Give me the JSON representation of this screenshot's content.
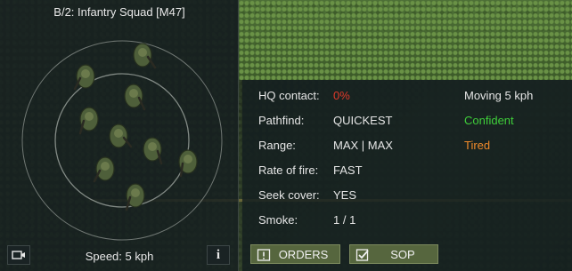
{
  "unit": {
    "title": "B/2: Infantry Squad [M47]",
    "speed": "Speed: 5 kph",
    "info_label": "i"
  },
  "stats": {
    "hq_contact_label": "HQ contact:",
    "hq_contact_value": "0%",
    "pathfind_label": "Pathfind:",
    "pathfind_value": "QUICKEST",
    "range_label": "Range:",
    "range_value": "MAX | MAX",
    "rate_label": "Rate of fire:",
    "rate_value": "FAST",
    "cover_label": "Seek cover:",
    "cover_value": "YES",
    "smoke_label": "Smoke:",
    "smoke_value": "1 / 1"
  },
  "status": {
    "movement": "Moving 5 kph",
    "morale": "Confident",
    "fatigue": "Tired"
  },
  "buttons": {
    "orders": "ORDERS",
    "sop": "SOP"
  },
  "colors": {
    "hq_contact_value": "#e03a2a",
    "morale": "#3fcf3a",
    "fatigue": "#f08a2a",
    "button_bg": "#56663e"
  },
  "icons": {
    "camera": "camera-icon",
    "info": "info-icon",
    "orders": "orders-icon",
    "sop": "checkbox-icon"
  }
}
